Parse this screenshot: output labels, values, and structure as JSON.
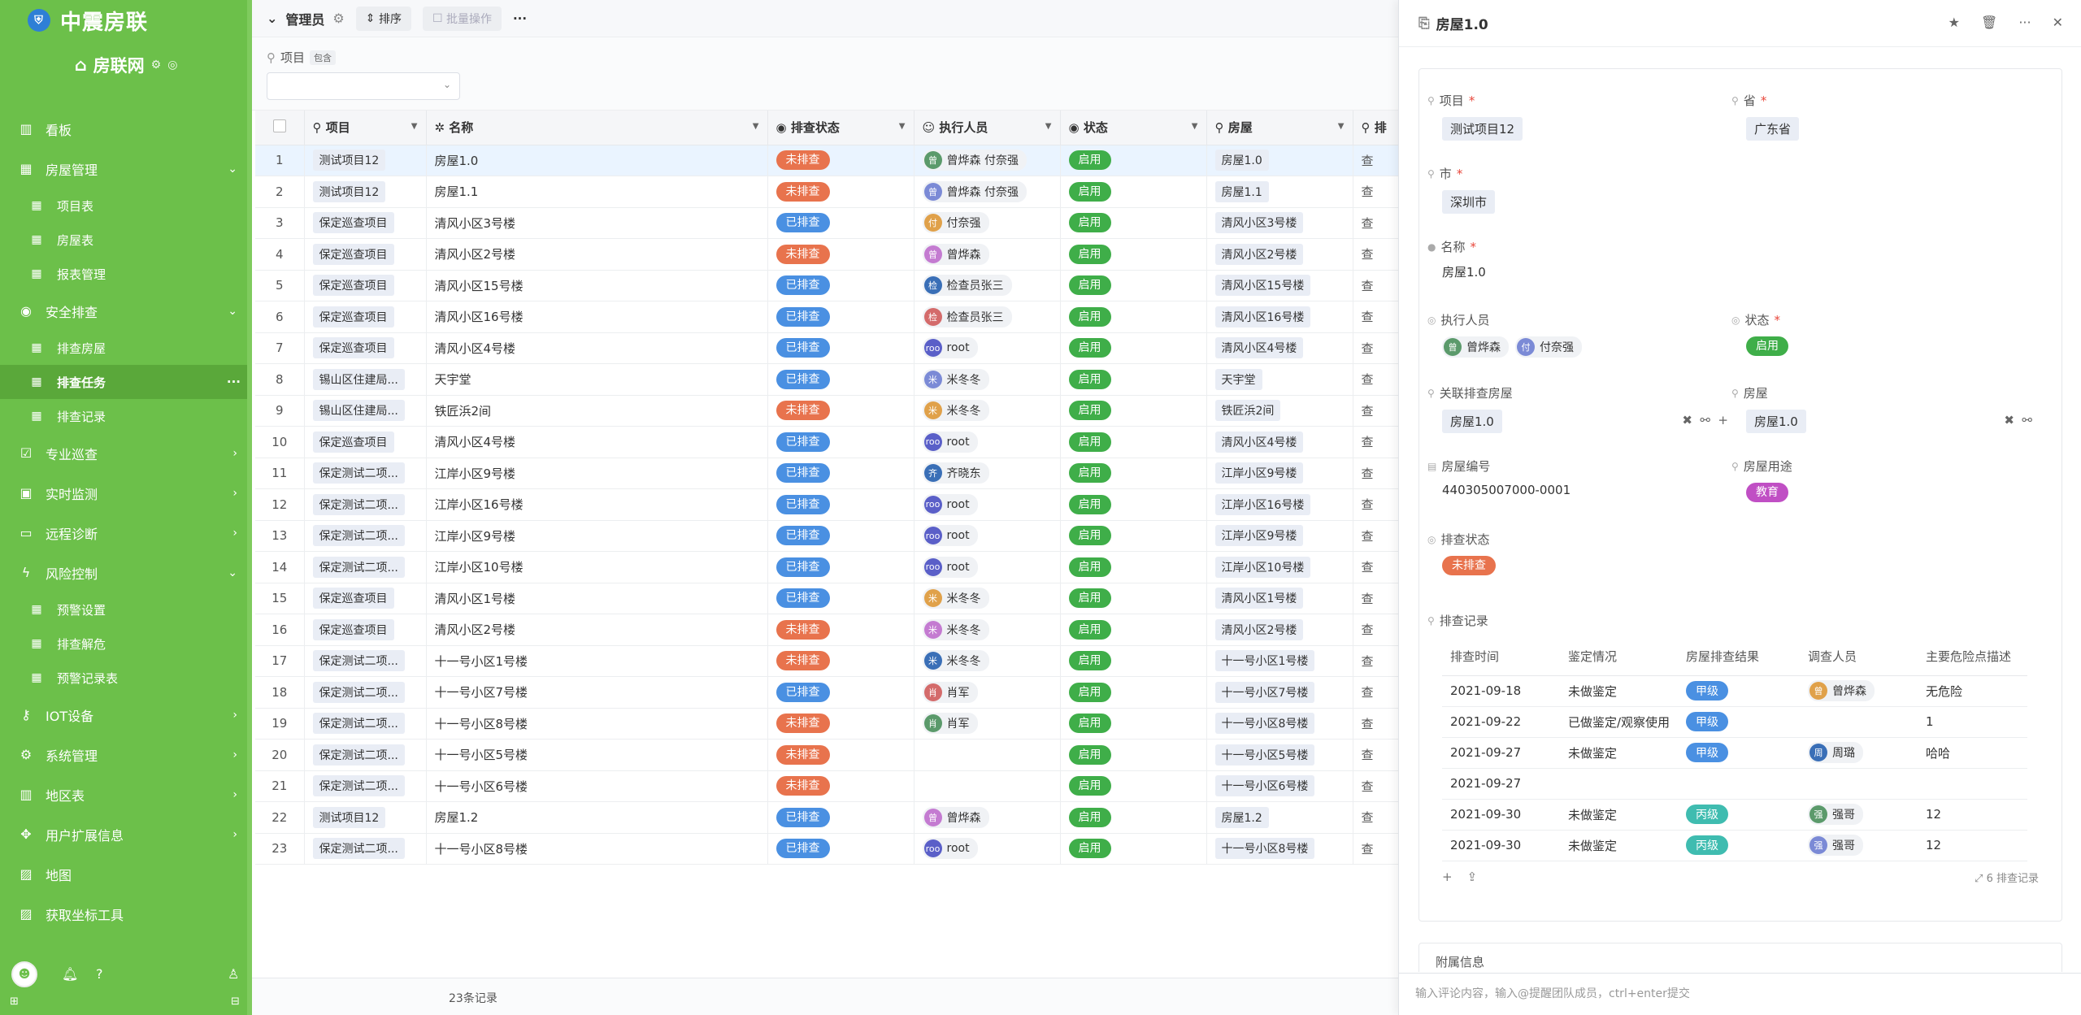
{
  "app": {
    "name": "中震房联",
    "workspace": "房联网"
  },
  "sidebar": {
    "items": [
      {
        "label": "看板",
        "icon": "chart-icon",
        "type": "item"
      },
      {
        "label": "房屋管理",
        "icon": "calendar-icon",
        "type": "group",
        "expanded": true
      },
      {
        "label": "项目表",
        "icon": "table-icon",
        "type": "sub"
      },
      {
        "label": "房屋表",
        "icon": "table-icon",
        "type": "sub"
      },
      {
        "label": "报表管理",
        "icon": "table-icon",
        "type": "sub"
      },
      {
        "label": "安全排查",
        "icon": "eye-icon",
        "type": "group",
        "expanded": true
      },
      {
        "label": "排查房屋",
        "icon": "table-icon",
        "type": "sub"
      },
      {
        "label": "排查任务",
        "icon": "table-icon",
        "type": "sub",
        "active": true
      },
      {
        "label": "排查记录",
        "icon": "table-icon",
        "type": "sub"
      },
      {
        "label": "专业巡查",
        "icon": "check-icon",
        "type": "group"
      },
      {
        "label": "实时监测",
        "icon": "monitor-icon",
        "type": "group"
      },
      {
        "label": "远程诊断",
        "icon": "desktop-icon",
        "type": "group"
      },
      {
        "label": "风险控制",
        "icon": "bolt-icon",
        "type": "group",
        "expanded": true
      },
      {
        "label": "预警设置",
        "icon": "table-icon",
        "type": "sub"
      },
      {
        "label": "排查解危",
        "icon": "table-icon",
        "type": "sub"
      },
      {
        "label": "预警记录表",
        "icon": "table-icon",
        "type": "sub"
      },
      {
        "label": "IOT设备",
        "icon": "lock-icon",
        "type": "group"
      },
      {
        "label": "系统管理",
        "icon": "gears-icon",
        "type": "group"
      },
      {
        "label": "地区表",
        "icon": "chart-icon",
        "type": "group"
      },
      {
        "label": "用户扩展信息",
        "icon": "move-icon",
        "type": "group"
      },
      {
        "label": "地图",
        "icon": "image-icon",
        "type": "item"
      },
      {
        "label": "获取坐标工具",
        "icon": "image-icon",
        "type": "item"
      }
    ]
  },
  "toolbar": {
    "view_name": "管理员",
    "sort_label": "排序",
    "batch_label": "批量操作",
    "more": "···"
  },
  "filter": {
    "field_label": "项目",
    "tag": "包含"
  },
  "grid": {
    "columns": [
      "项目",
      "名称",
      "排查状态",
      "执行人员",
      "状态",
      "房屋",
      "排"
    ],
    "rows": [
      {
        "n": "1",
        "project": "测试项目12",
        "name": "房屋1.0",
        "check": "未排查",
        "person": "曾烨森 付奈强",
        "status": "启用",
        "house": "房屋1.0",
        "selected": true
      },
      {
        "n": "2",
        "project": "测试项目12",
        "name": "房屋1.1",
        "check": "未排查",
        "person": "曾烨森 付奈强",
        "status": "启用",
        "house": "房屋1.1"
      },
      {
        "n": "3",
        "project": "保定巡查项目",
        "name": "清风小区3号楼",
        "check": "已排查",
        "person": "付奈强",
        "status": "启用",
        "house": "清风小区3号楼"
      },
      {
        "n": "4",
        "project": "保定巡查项目",
        "name": "清风小区2号楼",
        "check": "未排查",
        "person": "曾烨森",
        "status": "启用",
        "house": "清风小区2号楼"
      },
      {
        "n": "5",
        "project": "保定巡查项目",
        "name": "清风小区15号楼",
        "check": "已排查",
        "person": "检查员张三",
        "status": "启用",
        "house": "清风小区15号楼"
      },
      {
        "n": "6",
        "project": "保定巡查项目",
        "name": "清风小区16号楼",
        "check": "已排查",
        "person": "检查员张三",
        "status": "启用",
        "house": "清风小区16号楼"
      },
      {
        "n": "7",
        "project": "保定巡查项目",
        "name": "清风小区4号楼",
        "check": "已排查",
        "person": "root",
        "status": "启用",
        "house": "清风小区4号楼"
      },
      {
        "n": "8",
        "project": "锡山区住建局...",
        "name": "天宇堂",
        "check": "已排查",
        "person": "米冬冬",
        "status": "启用",
        "house": "天宇堂"
      },
      {
        "n": "9",
        "project": "锡山区住建局...",
        "name": "铁匠浜2间",
        "check": "未排查",
        "person": "米冬冬",
        "status": "启用",
        "house": "铁匠浜2间"
      },
      {
        "n": "10",
        "project": "保定巡查项目",
        "name": "清风小区4号楼",
        "check": "已排查",
        "person": "root",
        "status": "启用",
        "house": "清风小区4号楼"
      },
      {
        "n": "11",
        "project": "保定测试二项...",
        "name": "江岸小区9号楼",
        "check": "已排查",
        "person": "齐晓东",
        "status": "启用",
        "house": "江岸小区9号楼"
      },
      {
        "n": "12",
        "project": "保定测试二项...",
        "name": "江岸小区16号楼",
        "check": "已排查",
        "person": "root",
        "status": "启用",
        "house": "江岸小区16号楼"
      },
      {
        "n": "13",
        "project": "保定测试二项...",
        "name": "江岸小区9号楼",
        "check": "已排查",
        "person": "root",
        "status": "启用",
        "house": "江岸小区9号楼"
      },
      {
        "n": "14",
        "project": "保定测试二项...",
        "name": "江岸小区10号楼",
        "check": "已排查",
        "person": "root",
        "status": "启用",
        "house": "江岸小区10号楼"
      },
      {
        "n": "15",
        "project": "保定巡查项目",
        "name": "清风小区1号楼",
        "check": "已排查",
        "person": "米冬冬",
        "status": "启用",
        "house": "清风小区1号楼"
      },
      {
        "n": "16",
        "project": "保定巡查项目",
        "name": "清风小区2号楼",
        "check": "未排查",
        "person": "米冬冬",
        "status": "启用",
        "house": "清风小区2号楼"
      },
      {
        "n": "17",
        "project": "保定测试二项...",
        "name": "十一号小区1号楼",
        "check": "未排查",
        "person": "米冬冬",
        "status": "启用",
        "house": "十一号小区1号楼"
      },
      {
        "n": "18",
        "project": "保定测试二项...",
        "name": "十一号小区7号楼",
        "check": "已排查",
        "person": "肖军",
        "status": "启用",
        "house": "十一号小区7号楼"
      },
      {
        "n": "19",
        "project": "保定测试二项...",
        "name": "十一号小区8号楼",
        "check": "未排查",
        "person": "肖军",
        "status": "启用",
        "house": "十一号小区8号楼"
      },
      {
        "n": "20",
        "project": "保定测试二项...",
        "name": "十一号小区5号楼",
        "check": "未排查",
        "person": "",
        "status": "启用",
        "house": "十一号小区5号楼"
      },
      {
        "n": "21",
        "project": "保定测试二项...",
        "name": "十一号小区6号楼",
        "check": "未排查",
        "person": "",
        "status": "启用",
        "house": "十一号小区6号楼"
      },
      {
        "n": "22",
        "project": "测试项目12",
        "name": "房屋1.2",
        "check": "已排查",
        "person": "曾烨森",
        "status": "启用",
        "house": "房屋1.2"
      },
      {
        "n": "23",
        "project": "保定测试二项...",
        "name": "十一号小区8号楼",
        "check": "已排查",
        "person": "root",
        "status": "启用",
        "house": "十一号小区8号楼"
      }
    ],
    "footer": "23条记录"
  },
  "panel": {
    "title": "房屋1.0",
    "fields": {
      "project_label": "项目",
      "project_value": "测试项目12",
      "province_label": "省",
      "province_value": "广东省",
      "city_label": "市",
      "city_value": "深圳市",
      "name_label": "名称",
      "name_value": "房屋1.0",
      "executor_label": "执行人员",
      "executor_1": "曾烨森",
      "executor_2": "付奈强",
      "status_label": "状态",
      "status_value": "启用",
      "linked_label": "关联排查房屋",
      "linked_value": "房屋1.0",
      "house_label": "房屋",
      "house_value": "房屋1.0",
      "code_label": "房屋编号",
      "code_value": "440305007000-0001",
      "usage_label": "房屋用途",
      "usage_value": "教育",
      "check_label": "排查状态",
      "check_value": "未排查",
      "records_label": "排查记录"
    },
    "records": {
      "headers": [
        "排查时间",
        "鉴定情况",
        "房屋排查结果",
        "调查人员",
        "主要危险点描述"
      ],
      "rows": [
        {
          "date": "2021-09-18",
          "appraisal": "未做鉴定",
          "result": "甲级",
          "person": "曾烨森",
          "desc": "无危险"
        },
        {
          "date": "2021-09-22",
          "appraisal": "已做鉴定/观察使用",
          "result": "甲级",
          "person": "",
          "desc": "1"
        },
        {
          "date": "2021-09-27",
          "appraisal": "未做鉴定",
          "result": "甲级",
          "person": "周璐",
          "desc": "哈哈"
        },
        {
          "date": "2021-09-27",
          "appraisal": "",
          "result": "",
          "person": "",
          "desc": ""
        },
        {
          "date": "2021-09-30",
          "appraisal": "未做鉴定",
          "result": "丙级",
          "person": "强哥",
          "desc": "12"
        },
        {
          "date": "2021-09-30",
          "appraisal": "未做鉴定",
          "result": "丙级",
          "person": "强哥",
          "desc": "12"
        }
      ],
      "count": "6 排查记录"
    },
    "section_next": "附属信息",
    "comment_placeholder": "输入评论内容，输入@提醒团队成员，ctrl+enter提交"
  },
  "colors": {
    "sidebar": "#6cc04a",
    "accent": "#4a90e2",
    "danger": "#e8734d",
    "success": "#3fae49"
  }
}
